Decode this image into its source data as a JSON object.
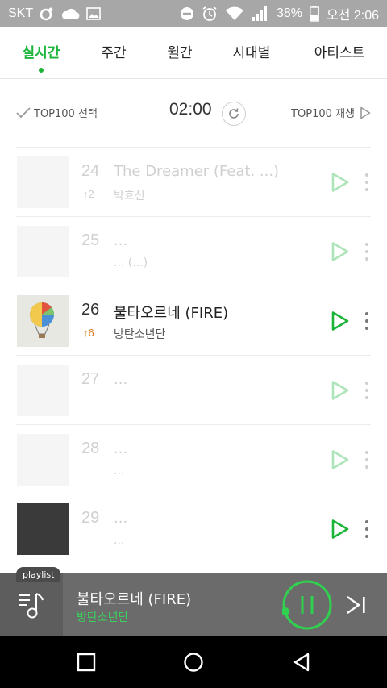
{
  "status_bar": {
    "carrier": "SKT",
    "battery": "38%",
    "time": "오전 2:06"
  },
  "tabs": [
    {
      "label": "실시간",
      "active": true
    },
    {
      "label": "주간",
      "active": false
    },
    {
      "label": "월간",
      "active": false
    },
    {
      "label": "시대별",
      "active": false
    },
    {
      "label": "아티스트",
      "active": false
    }
  ],
  "toolbar": {
    "select_label": "TOP100 선택",
    "time": "02:00",
    "play_label": "TOP100 재생"
  },
  "chart": {
    "rows": [
      {
        "rank": "24",
        "change": "↑2",
        "title": "The Dreamer (Feat. ...)",
        "artist": "박효신",
        "faded": true
      },
      {
        "rank": "25",
        "change": "",
        "title": "...",
        "artist": "... (...)",
        "faded": true
      },
      {
        "rank": "26",
        "change": "↑6",
        "title": "불타오르네 (FIRE)",
        "artist": "방탄소년단",
        "faded": false
      },
      {
        "rank": "27",
        "change": "",
        "title": "...",
        "artist": "",
        "faded": true
      },
      {
        "rank": "28",
        "change": "",
        "title": "...",
        "artist": "...",
        "faded": true
      },
      {
        "rank": "29",
        "change": "",
        "title": "...",
        "artist": "...",
        "faded": true
      }
    ]
  },
  "player": {
    "playlist_label": "playlist",
    "title": "불타오르네 (FIRE)",
    "artist": "방탄소년단"
  },
  "colors": {
    "accent": "#1bb53a",
    "rank_up": "#e07b22"
  }
}
